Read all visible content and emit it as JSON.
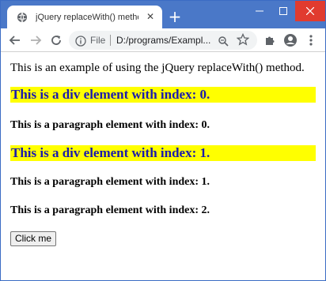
{
  "browser": {
    "tab_title": "jQuery replaceWith() method",
    "new_tab_symbol": "+",
    "address": {
      "scheme_label": "File",
      "url": "D:/programs/Exampl..."
    }
  },
  "page": {
    "intro": "This is an example of using the jQuery replaceWith() method.",
    "div_0": "This is a div element with index: 0.",
    "para_0": "This is a paragraph element with index: 0.",
    "div_1": "This is a div element with index: 1.",
    "para_1": "This is a paragraph element with index: 1.",
    "para_2": "This is a paragraph element with index: 2.",
    "button_label": "Click me"
  },
  "colors": {
    "titlebar": "#4a78c8",
    "div_highlight": "#ffff00",
    "div_text": "#1a1aad",
    "close_button": "#e13b2f"
  }
}
